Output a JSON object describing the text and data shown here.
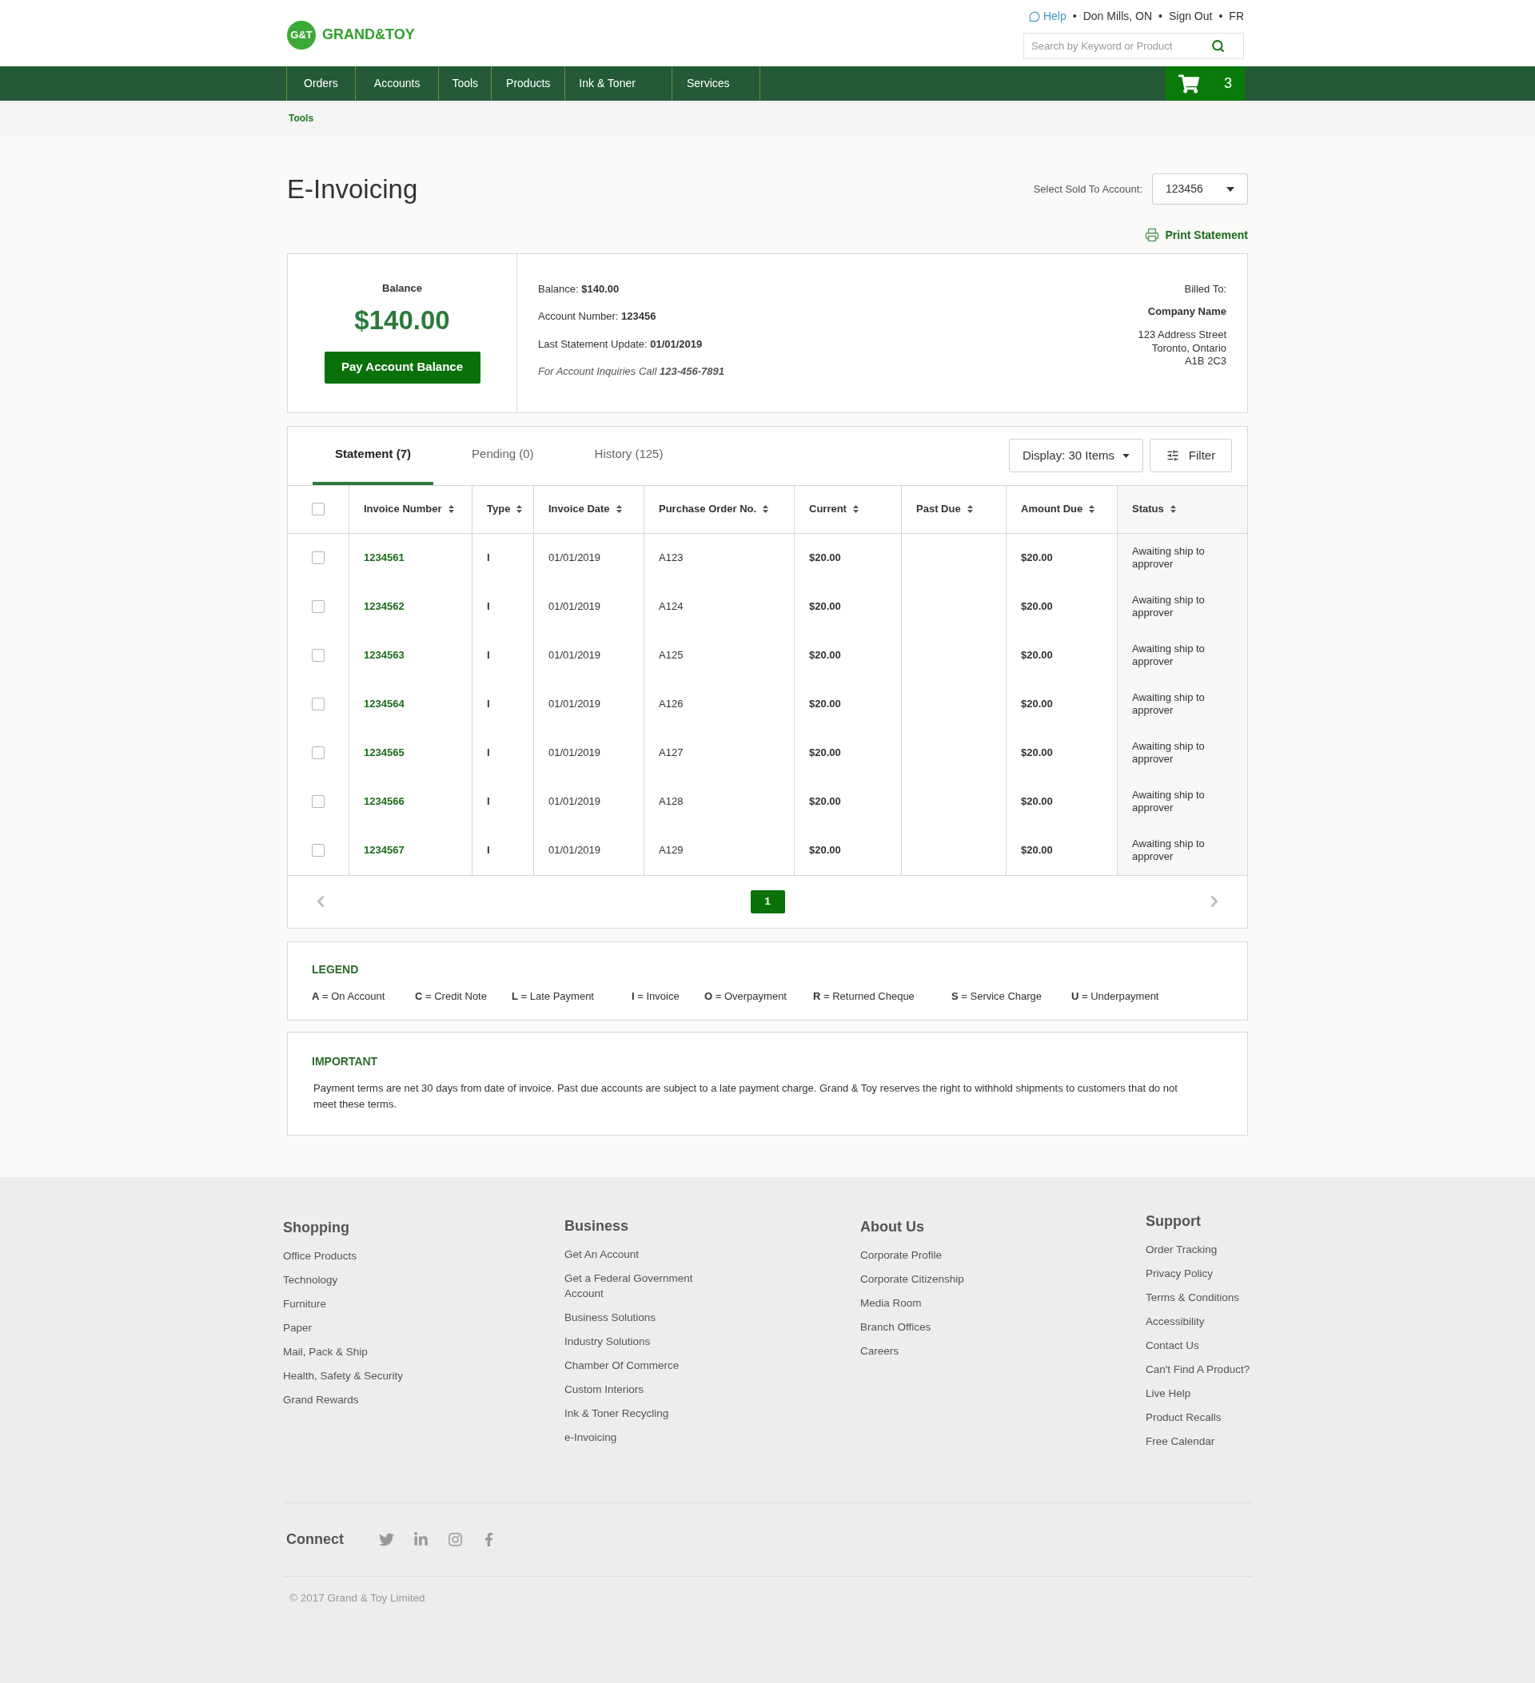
{
  "header": {
    "logo_mark": "G&T",
    "logo_text": "GRAND&TOY",
    "help": "Help",
    "separator": "•",
    "location": "Don Mills, ON",
    "sign_out": "Sign Out",
    "language": "FR",
    "search": {
      "placeholder": "Search by Keyword or Product"
    }
  },
  "nav": [
    {
      "label": "Orders"
    },
    {
      "label": "Accounts"
    },
    {
      "label": "Tools"
    },
    {
      "label": "Products"
    },
    {
      "label": "Ink & Toner"
    },
    {
      "label": "Services"
    }
  ],
  "cart": {
    "count": "3"
  },
  "breadcrumb": "Tools",
  "page": {
    "title": "E-Invoicing",
    "account_label": "Select Sold To Account:",
    "account_value": "123456",
    "print": "Print Statement"
  },
  "balance": {
    "label": "Balance",
    "amount": "$140.00",
    "pay_button": "Pay Account Balance",
    "details": [
      "Balance: **$140.00**",
      "Account Number: **123456**",
      "Last Statement Update: **01/01/2019**"
    ],
    "inquiries": "For Account Inquiries Call **123-456-7891**",
    "billed_label": "Billed To:",
    "company": "Company Name",
    "address": [
      "123 Address Street",
      "Toronto, Ontario",
      "A1B 2C3"
    ]
  },
  "tabs": [
    {
      "label": "Statement (7)",
      "selected": true
    },
    {
      "label": "Pending (0)",
      "selected": false
    },
    {
      "label": "History (125)",
      "selected": false
    }
  ],
  "display": "Display: 30 Items",
  "filter": "Filter",
  "table": {
    "select_all": false,
    "columns": [
      "Invoice Number",
      "Type",
      "Invoice Date",
      "Purchase Order No.",
      "Current",
      "Past Due",
      "Amount Due",
      "Status"
    ],
    "rows": [
      {
        "checked": false,
        "invoice": "1234561",
        "type": "I",
        "date": "01/01/2019",
        "po": "A123",
        "current": "$20.00",
        "amount_due": "$20.00",
        "status": "Awaiting ship to approver"
      },
      {
        "checked": false,
        "invoice": "1234562",
        "type": "I",
        "date": "01/01/2019",
        "po": "A124",
        "current": "$20.00",
        "amount_due": "$20.00",
        "status": "Awaiting ship to approver"
      },
      {
        "checked": false,
        "invoice": "1234563",
        "type": "I",
        "date": "01/01/2019",
        "po": "A125",
        "current": "$20.00",
        "amount_due": "$20.00",
        "status": "Awaiting ship to approver"
      },
      {
        "checked": false,
        "invoice": "1234564",
        "type": "I",
        "date": "01/01/2019",
        "po": "A126",
        "current": "$20.00",
        "amount_due": "$20.00",
        "status": "Awaiting ship to approver"
      },
      {
        "checked": false,
        "invoice": "1234565",
        "type": "I",
        "date": "01/01/2019",
        "po": "A127",
        "current": "$20.00",
        "amount_due": "$20.00",
        "status": "Awaiting ship to approver"
      },
      {
        "checked": false,
        "invoice": "1234566",
        "type": "I",
        "date": "01/01/2019",
        "po": "A128",
        "current": "$20.00",
        "amount_due": "$20.00",
        "status": "Awaiting ship to approver"
      },
      {
        "checked": false,
        "invoice": "1234567",
        "type": "I",
        "date": "01/01/2019",
        "po": "A129",
        "current": "$20.00",
        "amount_due": "$20.00",
        "status": "Awaiting ship to approver"
      }
    ]
  },
  "pagination": [
    {
      "label": "1",
      "selected": true
    }
  ],
  "legend": {
    "title": "LEGEND",
    "items": [
      "**A** = On Account",
      "**C** = Credit Note",
      "**L** = Late Payment",
      "**I** = Invoice",
      "**O** = Overpayment",
      "**R** = Returned Cheque",
      "**S** = Service Charge",
      "**U** = Underpayment"
    ]
  },
  "important": {
    "title": "IMPORTANT",
    "text": "Payment terms are net 30 days from date of invoice. Past due accounts are subject to a late payment charge. Grand & Toy reserves the right to withhold shipments to customers that do not meet these terms."
  },
  "footer": {
    "columns": [
      {
        "title": "Shopping",
        "links": [
          "Office Products",
          "Technology",
          "Furniture",
          "Paper",
          "Mail, Pack & Ship",
          "Health, Safety & Security",
          "Grand Rewards"
        ]
      },
      {
        "title": "Business",
        "links": [
          "Get An Account",
          "Get a Federal Government Account",
          "Business Solutions",
          "Industry Solutions",
          "Chamber Of Commerce",
          "Custom Interiors",
          "Ink & Toner Recycling",
          "e-Invoicing"
        ]
      },
      {
        "title": "About Us",
        "links": [
          "Corporate Profile",
          "Corporate Citizenship",
          "Media Room",
          "Branch Offices",
          "Careers"
        ]
      },
      {
        "title": "Support",
        "links": [
          "Order Tracking",
          "Privacy Policy",
          "Terms & Conditions",
          "Accessibility",
          "Contact Us",
          "Can't Find A Product?",
          "Live Help",
          "Product Recalls",
          "Free Calendar"
        ]
      }
    ],
    "connect": "Connect",
    "copyright": "© 2017 Grand & Toy Limited"
  }
}
